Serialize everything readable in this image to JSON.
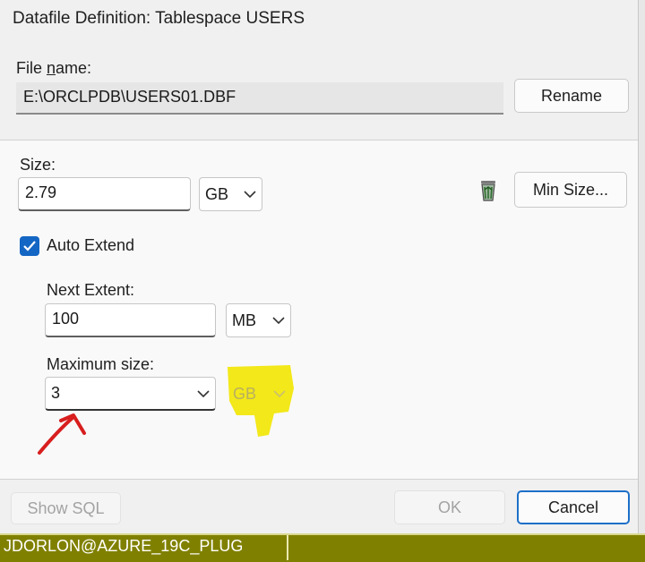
{
  "window": {
    "title": "Datafile Definition: Tablespace USERS"
  },
  "file": {
    "label_pre": "File ",
    "label_underlined": "n",
    "label_post": "ame:",
    "value": "E:\\ORCLPDB\\USERS01.DBF",
    "rename_label": "Rename"
  },
  "size": {
    "label": "Size:",
    "value": "2.79",
    "unit": "GB",
    "min_size_label": "Min Size..."
  },
  "auto_extend": {
    "label": "Auto Extend",
    "checked": true,
    "next_extent": {
      "label": "Next Extent:",
      "value": "100",
      "unit": "MB"
    },
    "max_size": {
      "label": "Maximum size:",
      "value": "3",
      "unit": "GB"
    }
  },
  "footer": {
    "show_sql_label": "Show SQL",
    "ok_label": "OK",
    "cancel_label": "Cancel"
  },
  "statusbar": {
    "connection": "JDORLON@AZURE_19C_PLUG"
  },
  "colors": {
    "accent": "#1466c4",
    "statusbar": "#808000",
    "highlight": "#f2e600",
    "arrow": "#d81e1e"
  }
}
